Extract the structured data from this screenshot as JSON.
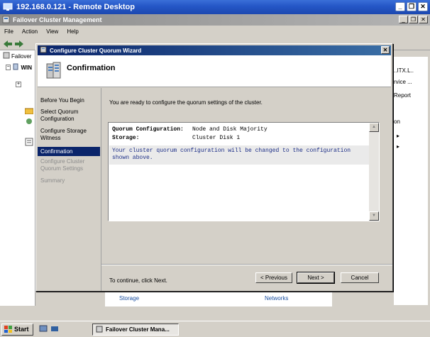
{
  "remote_desktop": {
    "title": "192.168.0.121 - Remote Desktop"
  },
  "app_window": {
    "title": "Failover Cluster Management",
    "menu": [
      "File",
      "Action",
      "View",
      "Help"
    ]
  },
  "background": {
    "tree_root": "Failover",
    "tree_child": "WIN",
    "right_items": [
      "..ITX.L..",
      "rvice ...",
      "Report",
      "on"
    ],
    "bottom_links": [
      "Storage",
      "Networks"
    ]
  },
  "wizard": {
    "title": "Configure Cluster Quorum Wizard",
    "header_title": "Confirmation",
    "nav": [
      {
        "label": "Before You Begin",
        "state": "normal"
      },
      {
        "label": "Select Quorum Configuration",
        "state": "normal"
      },
      {
        "label": "Configure Storage Witness",
        "state": "normal"
      },
      {
        "label": "Confirmation",
        "state": "active"
      },
      {
        "label": "Configure Cluster Quorum Settings",
        "state": "disabled"
      },
      {
        "label": "Summary",
        "state": "disabled"
      }
    ],
    "ready_text": "You are ready to configure the quorum settings of the cluster.",
    "summary": {
      "rows": [
        {
          "label": "Quorum Configuration:",
          "value": "Node and Disk Majority"
        },
        {
          "label": "Storage:",
          "value": "Cluster Disk 1"
        }
      ],
      "note": "Your cluster quorum configuration will be changed to the configuration shown above."
    },
    "continue_text": "To continue, click Next.",
    "buttons": {
      "previous": "< Previous",
      "next": "Next >",
      "cancel": "Cancel"
    }
  },
  "taskbar": {
    "start": "Start",
    "task": "Failover Cluster Mana..."
  },
  "colors": {
    "rd_titlebar": "#2456c6",
    "wizard_titlebar": "#0a246a",
    "nav_active": "#0a246a",
    "note_text": "#1a2c86"
  }
}
